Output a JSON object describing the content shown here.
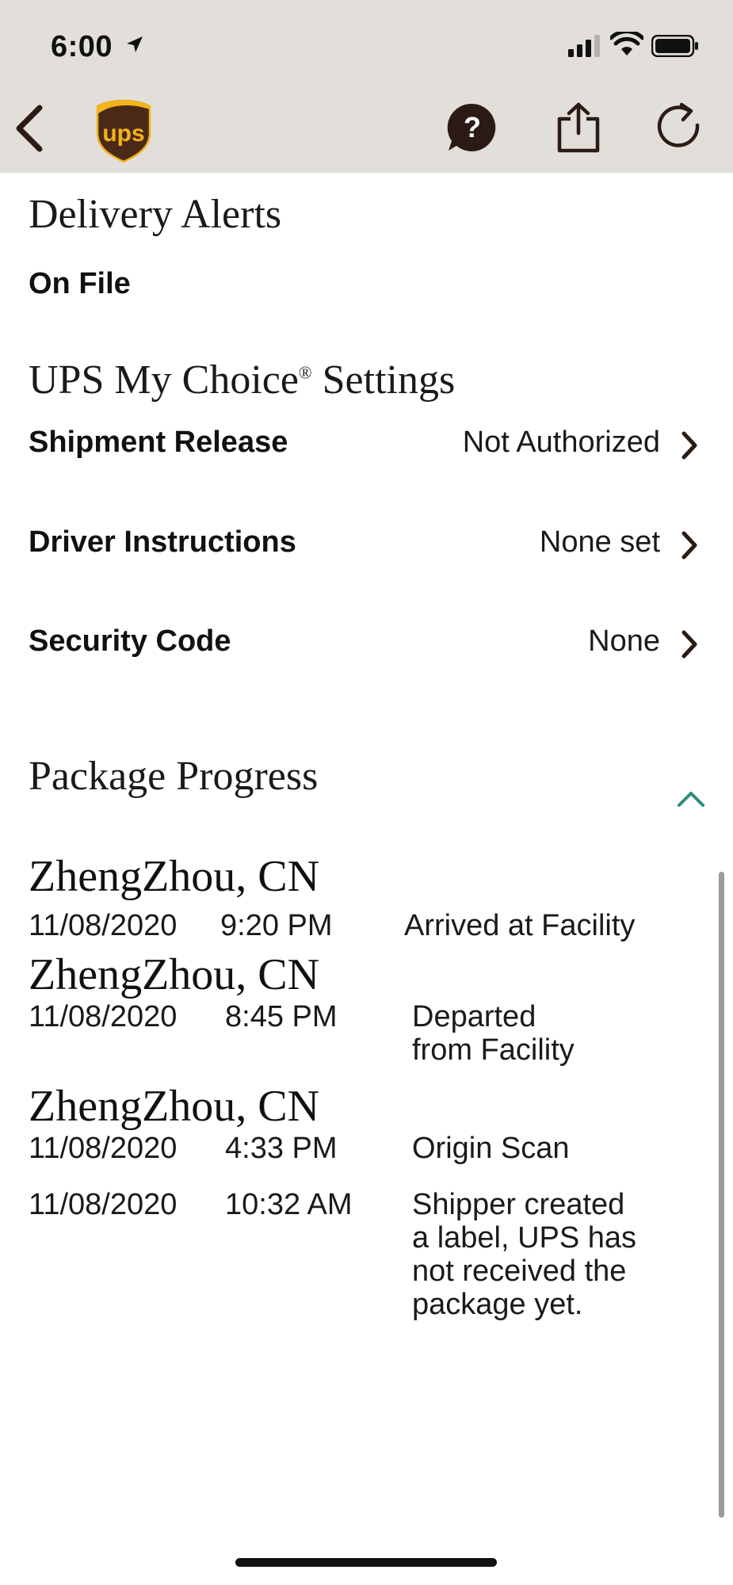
{
  "status_bar": {
    "time": "6:00"
  },
  "nav": {
    "logo_text": "ups",
    "icons": {
      "back": "chevron-left-icon",
      "help": "help-bubble-icon",
      "share": "share-icon",
      "refresh": "refresh-icon"
    },
    "colors": {
      "logo_shield": "#4a2a17",
      "logo_gold": "#f4b41a",
      "icon_dark": "#2b1b14"
    }
  },
  "delivery_alerts": {
    "heading": "Delivery Alerts",
    "status": "On File"
  },
  "my_choice": {
    "heading": "UPS My Choice",
    "reg_mark": "®",
    "heading_suffix": " Settings",
    "rows": [
      {
        "label": "Shipment Release",
        "value": "Not Authorized"
      },
      {
        "label": "Driver Instructions",
        "value": "None set"
      },
      {
        "label": "Security Code",
        "value": "None"
      }
    ]
  },
  "package_progress": {
    "heading": "Package Progress",
    "accent": "#2e8b7a",
    "events": [
      {
        "location": "ZhengZhou, CN",
        "date": "11/08/2020",
        "time": "9:20 PM",
        "desc": "Arrived at Facility"
      },
      {
        "location": "ZhengZhou, CN",
        "date": "11/08/2020",
        "time": "8:45 PM",
        "desc_lines": [
          "Departed",
          "from Facility"
        ]
      },
      {
        "location": "ZhengZhou, CN",
        "date": "11/08/2020",
        "time": "4:33 PM",
        "desc": "Origin Scan"
      },
      {
        "date": "11/08/2020",
        "time": "10:32 AM",
        "desc_lines": [
          "Shipper created",
          "a label, UPS has",
          "not received the",
          "package yet."
        ]
      }
    ]
  }
}
